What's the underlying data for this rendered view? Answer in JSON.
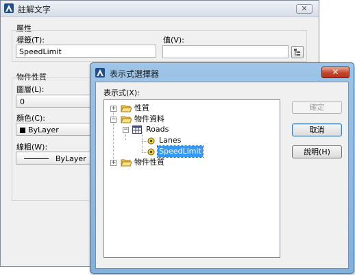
{
  "back_dialog": {
    "title": "註解文字",
    "close_label": "✕",
    "attributes_group": "屬性",
    "tag_label": "標籤(T):",
    "tag_value": "SpeedLimit",
    "value_label": "值(V):",
    "value_value": "",
    "properties_group": "物件性質",
    "layer_label": "圖層(L):",
    "layer_value": "0",
    "color_label": "顏色(C):",
    "color_value": "ByLayer",
    "linetype_label": "線粗(W):",
    "linetype_value": "ByLayer"
  },
  "front_dialog": {
    "title": "表示式選擇器",
    "close_label": "✕",
    "expression_label": "表示式(X):",
    "tree": {
      "properties": "性質",
      "object_data": "物件資料",
      "roads": "Roads",
      "lanes": "Lanes",
      "speedlimit": "SpeedLimit",
      "object_properties": "物件性質"
    },
    "buttons": {
      "ok": "確定",
      "cancel": "取消",
      "help": "說明(H)"
    }
  },
  "colors": {
    "title_blue": "#9ec4e6",
    "close_red": "#c4452b",
    "selection_blue": "#3399ff",
    "folder_yellow": "#f5c542"
  }
}
